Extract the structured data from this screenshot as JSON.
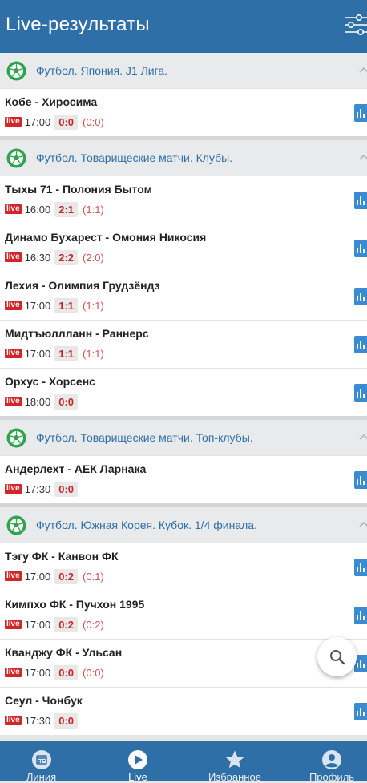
{
  "header": {
    "title": "Live-результаты"
  },
  "leagues": [
    {
      "name": "Футбол. Япония. J1 Лига.",
      "matches": [
        {
          "teams": "Кобе - Хиросима",
          "live": "live",
          "time": "17:00",
          "score": "0:0",
          "half": "(0:0)"
        }
      ]
    },
    {
      "name": "Футбол. Товарищеские матчи. Клубы.",
      "matches": [
        {
          "teams": "Тыхы 71 - Полония Бытом",
          "live": "live",
          "time": "16:00",
          "score": "2:1",
          "half": "(1:1)"
        },
        {
          "teams": "Динамо Бухарест - Омония Никосия",
          "live": "live",
          "time": "16:30",
          "score": "2:2",
          "half": "(2:0)"
        },
        {
          "teams": "Лехия - Олимпия Грудзёндз",
          "live": "live",
          "time": "17:00",
          "score": "1:1",
          "half": "(1:1)"
        },
        {
          "teams": "Мидтъюллланн - Раннерс",
          "live": "live",
          "time": "17:00",
          "score": "1:1",
          "half": "(1:1)"
        },
        {
          "teams": "Орхус - Хорсенс",
          "live": "live",
          "time": "18:00",
          "score": "0:0",
          "half": ""
        }
      ]
    },
    {
      "name": "Футбол. Товарищеские матчи. Топ-клубы.",
      "matches": [
        {
          "teams": "Андерлехт - АЕК Ларнака",
          "live": "live",
          "time": "17:30",
          "score": "0:0",
          "half": ""
        }
      ]
    },
    {
      "name": "Футбол. Южная Корея. Кубок. 1/4 финала.",
      "matches": [
        {
          "teams": "Тэгу ФК - Канвон ФК",
          "live": "live",
          "time": "17:00",
          "score": "0:2",
          "half": "(0:1)"
        },
        {
          "teams": "Кимпхо ФК - Пучхон 1995",
          "live": "live",
          "time": "17:00",
          "score": "0:2",
          "half": "(0:2)"
        },
        {
          "teams": "Кванджу ФК - Ульсан",
          "live": "live",
          "time": "17:00",
          "score": "0:0",
          "half": "(0:0)"
        },
        {
          "teams": "Сеул - Чонбук",
          "live": "live",
          "time": "17:30",
          "score": "0:0",
          "half": ""
        }
      ]
    }
  ],
  "bottom_nav": [
    {
      "label": "Линия",
      "icon": "calendar-icon"
    },
    {
      "label": "Live",
      "icon": "play-icon"
    },
    {
      "label": "Избранное",
      "icon": "star-icon"
    },
    {
      "label": "Профиль",
      "icon": "user-icon"
    }
  ],
  "colors": {
    "primary": "#2f6fa7",
    "live_badge": "#d2262a",
    "score_text": "#c8282a",
    "stats_button": "#3a8bd0",
    "league_bg": "#e9eaec"
  }
}
